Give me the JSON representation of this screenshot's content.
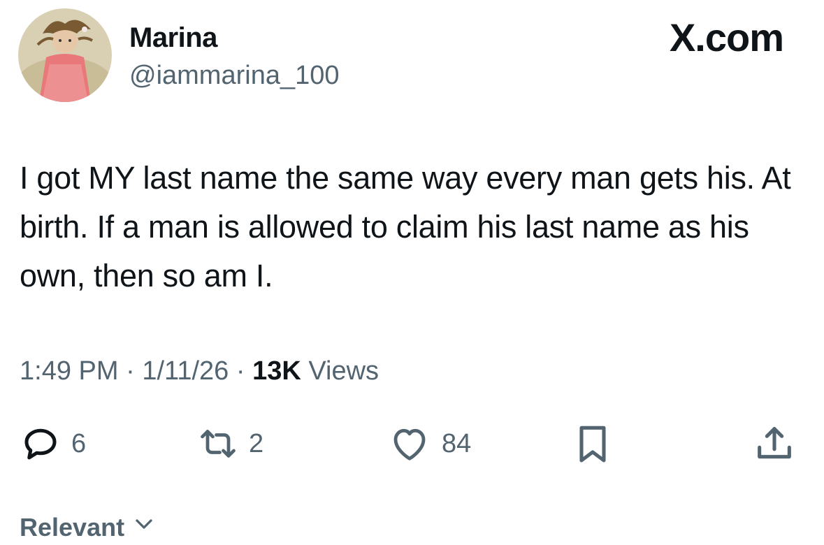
{
  "author": {
    "display_name": "Marina",
    "handle": "@iammarina_100"
  },
  "brand": "X.com",
  "tweet": {
    "text": "I got MY last name the same way every man gets his. At birth. If a man is allowed to claim his last name as his own, then so am I."
  },
  "meta": {
    "time": "1:49 PM",
    "separator": "·",
    "date": "1/11/26",
    "views_count": "13K",
    "views_label": "Views"
  },
  "actions": {
    "replies": "6",
    "reposts": "2",
    "likes": "84",
    "icons": [
      "reply-icon",
      "repost-icon",
      "like-icon",
      "bookmark-icon",
      "share-icon"
    ]
  },
  "sort": {
    "label": "Relevant"
  },
  "colors": {
    "text": "#0f1419",
    "secondary": "#536471",
    "background": "#ffffff"
  }
}
